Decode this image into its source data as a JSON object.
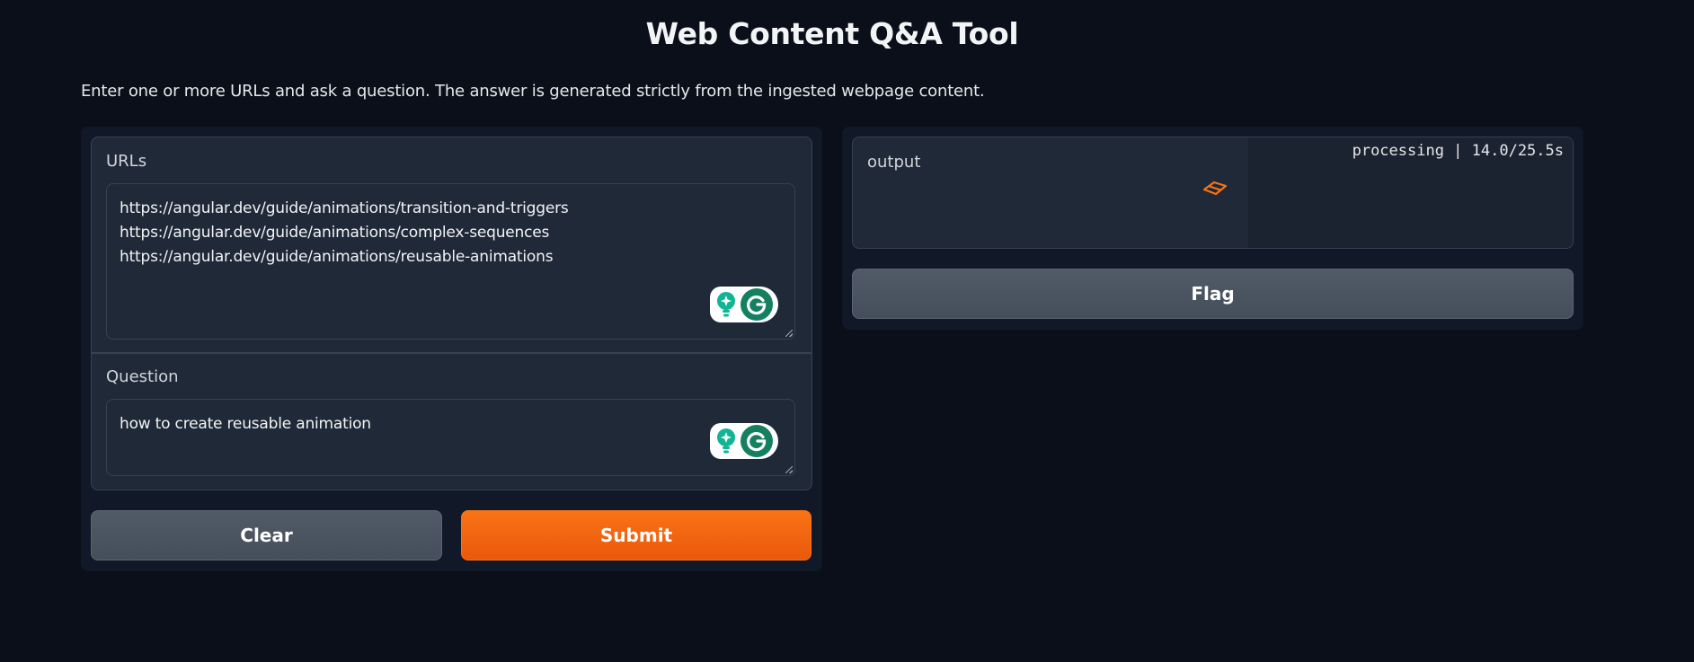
{
  "app": {
    "title": "Web Content Q&A Tool",
    "description": "Enter one or more URLs and ask a question. The answer is generated strictly from the ingested webpage content."
  },
  "inputs": {
    "urls": {
      "label": "URLs",
      "lines": [
        "https://angular.dev/guide/animations/transition-and-triggers",
        "https://angular.dev/guide/animations/complex-sequences",
        "https://angular.dev/guide/animations/reusable-animations"
      ]
    },
    "question": {
      "label": "Question",
      "value": "how to create reusable animation"
    }
  },
  "actions": {
    "clear_label": "Clear",
    "submit_label": "Submit",
    "flag_label": "Flag"
  },
  "output": {
    "label": "output",
    "status": "processing | 14.0/25.5s"
  },
  "icons": {
    "grammarly": [
      "lightbulb-icon",
      "grammarly-g-icon"
    ],
    "loader": "loading-spinner-icon"
  },
  "colors": {
    "background": "#0b0f19",
    "panel": "#111827",
    "card": "#1f2937",
    "border": "#374151",
    "primary": "#f97316",
    "secondary": "#4b5563",
    "grammarly_green": "#15805f",
    "grammarly_teal": "#11b595"
  }
}
